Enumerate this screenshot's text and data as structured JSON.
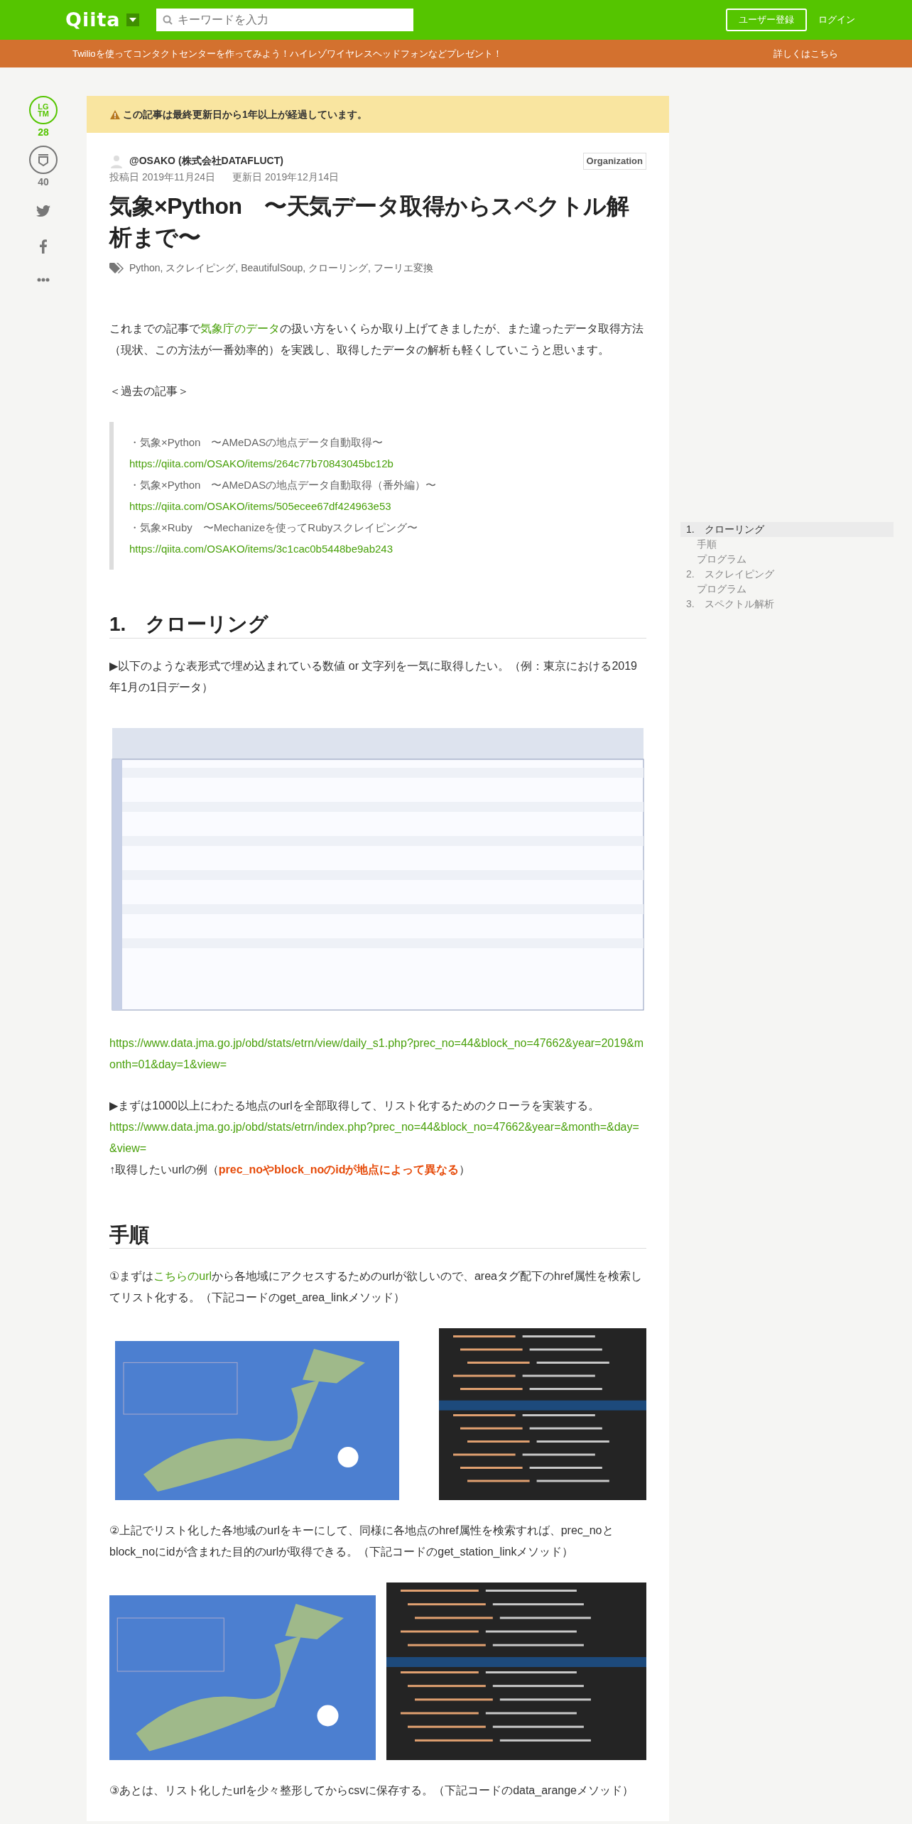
{
  "header": {
    "logo": "Qiita",
    "search": {
      "placeholder": "キーワードを入力"
    },
    "signup": "ユーザー登録",
    "login": "ログイン"
  },
  "promo": {
    "text": "Twilioを使ってコンタクトセンターを作ってみよう！ハイレゾワイヤレスヘッドフォンなどプレゼント！",
    "link": "詳しくはこちら"
  },
  "side_actions": {
    "lgtm_label": "LG TM",
    "lgtm_count": "28",
    "stock_count": "40"
  },
  "alert": "この記事は最終更新日から1年以上が経過しています。",
  "author": "@OSAKO (株式会社DATAFLUCT)",
  "org_badge": "Organization",
  "dates": [
    "投稿日 2019年11月24日",
    "更新日 2019年12月14日"
  ],
  "title": "気象×Python　〜天気データ取得からスペクトル解析まで〜",
  "tags": "Python, スクレイピング, BeautifulSoup, クローリング, フーリエ変換",
  "content": [
    {
      "kind": "paragraph",
      "parts": [
        {
          "text": "これまでの記事で",
          "kind": "plain"
        },
        {
          "text": "気象庁のデータ",
          "kind": "link"
        },
        {
          "text": "の扱い方をいくらか取り上げてきましたが、また違ったデータ取得方法（現状、この方法が一番効率的）を実践し、取得したデータの解析も軽くしていこうと思います。",
          "kind": "plain"
        }
      ]
    },
    {
      "kind": "paragraph",
      "parts": [
        {
          "text": "＜過去の記事＞",
          "kind": "plain"
        }
      ]
    },
    {
      "kind": "blockquote",
      "lines": [
        {
          "text": "・気象×Python　〜AMeDASの地点データ自動取得〜",
          "kind": "plain"
        },
        {
          "text": "https://qiita.com/OSAKO/items/264c77b70843045bc12b",
          "kind": "link"
        },
        {
          "text": "・気象×Python　〜AMeDASの地点データ自動取得（番外編）〜",
          "kind": "plain"
        },
        {
          "text": "https://qiita.com/OSAKO/items/505ecee67df424963e53",
          "kind": "link"
        },
        {
          "text": "・気象×Ruby　〜Mechanizeを使ってRubyスクレイピング〜",
          "kind": "plain"
        },
        {
          "text": "https://qiita.com/OSAKO/items/3c1cac0b5448be9ab243",
          "kind": "link"
        }
      ]
    },
    {
      "kind": "heading",
      "text": "1.　クローリング"
    },
    {
      "kind": "paragraph",
      "parts": [
        {
          "text": "▶以下のような表形式で埋め込まれている数値 or 文字列を一気に取得したい。（例：東京における2019年1月の1日データ）",
          "kind": "plain"
        }
      ]
    },
    {
      "kind": "images"
    },
    {
      "kind": "paragraph",
      "parts": [
        {
          "text": "https://www.data.jma.go.jp/obd/stats/etrn/view/daily_s1.php?prec_no=44&block_no=47662&year=2019&month=01&day=1&view=",
          "kind": "link_block"
        }
      ]
    },
    {
      "kind": "paragraph",
      "parts": [
        {
          "text": "▶まずは1000以上にわたる地点のurlを全部取得して、リスト化するためのクローラを実装する。",
          "kind": "plain"
        },
        {
          "text": "https://www.data.jma.go.jp/obd/stats/etrn/index.php?prec_no=44&block_no=47662&year=&month=&day=&view=",
          "kind": "link_block"
        },
        {
          "text": "↑取得したいurlの例（",
          "kind": "plain"
        },
        {
          "text": "prec_noやblock_noのidが地点によって異なる",
          "kind": "alert"
        },
        {
          "text": "）",
          "kind": "plain"
        }
      ]
    },
    {
      "kind": "heading",
      "text": "手順"
    },
    {
      "kind": "paragraph",
      "parts": [
        {
          "text": "①まずは",
          "kind": "plain"
        },
        {
          "text": "こちらのurl",
          "kind": "link"
        },
        {
          "text": "から各地域にアクセスするためのurlが欲しいので、areaタグ配下のhref属性を検索してリスト化する。（下記コードのget_area_linkメソッド）",
          "kind": "plain"
        }
      ]
    },
    {
      "kind": "images"
    },
    {
      "kind": "paragraph",
      "parts": [
        {
          "text": "②上記でリスト化した各地域のurlをキーにして、同様に各地点のhref属性を検索すれば、prec_noとblock_noにidが含まれた目的のurlが取得できる。（下記コードのget_station_linkメソッド）",
          "kind": "plain"
        }
      ]
    },
    {
      "kind": "images"
    },
    {
      "kind": "paragraph",
      "parts": [
        {
          "text": "③あとは、リスト化したurlを少々整形してからcsvに保存する。（下記コードのdata_arangeメソッド）",
          "kind": "plain"
        }
      ]
    }
  ],
  "toc": [
    {
      "number": "1.",
      "label": "クローリング",
      "selected": true,
      "children": [
        {
          "label": "手順",
          "selected": false
        },
        {
          "label": "プログラム",
          "selected": false
        }
      ]
    },
    {
      "number": "2.",
      "label": "スクレイピング",
      "selected": false,
      "children": [
        {
          "label": "プログラム",
          "selected": false
        }
      ]
    },
    {
      "number": "3.",
      "label": "スペクトル解析",
      "selected": false
    }
  ]
}
